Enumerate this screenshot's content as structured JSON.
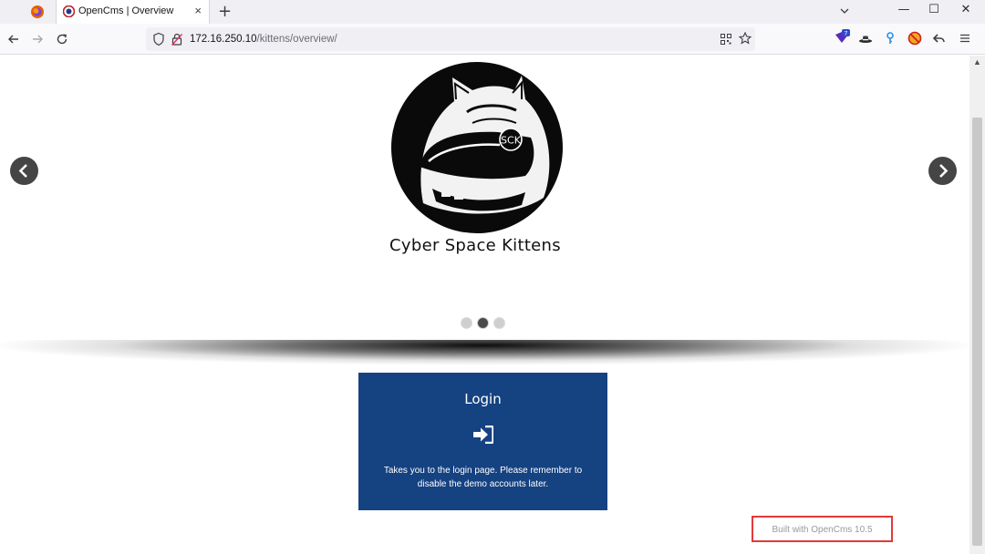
{
  "browser": {
    "tab": {
      "title": "OpenCms | Overview",
      "close": "×"
    },
    "new_tab": "+",
    "window_controls": {
      "minimize": "—",
      "maximize": "☐",
      "close": "✕"
    },
    "url": {
      "host": "172.16.250.10",
      "path": "/kittens/overview/"
    },
    "icons": [
      "firefox-icon",
      "back-icon",
      "forward-icon",
      "reload-icon",
      "shield-icon",
      "insecure-lock-icon",
      "qr-code-icon",
      "bookmark-star-icon",
      "extension-badge-icon",
      "hat-icon",
      "key-icon",
      "blocker-icon",
      "undo-icon",
      "menu-icon"
    ],
    "extension_badge_count": "7"
  },
  "page": {
    "slider": {
      "brand": "Cyber Space Kittens",
      "logo_monogram": "SCK",
      "dots": 3,
      "active_dot": 1
    },
    "login": {
      "title": "Login",
      "description": "Takes you to the login page. Please remember to disable the demo accounts later."
    },
    "footer": {
      "built_with": "Built with OpenCms 10.5"
    }
  },
  "colors": {
    "login_box": "#154281",
    "highlight": "#e23a3a",
    "arrow": "#454545"
  }
}
